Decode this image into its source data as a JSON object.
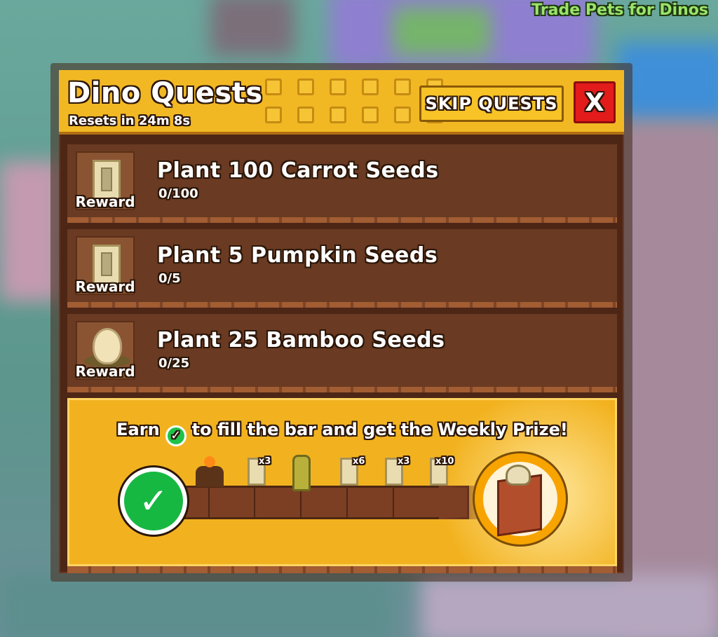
{
  "overlay": {
    "trade_label": "Trade Pets for Dinos"
  },
  "header": {
    "title": "Dino Quests",
    "reset_text": "Resets in 24m 8s",
    "skip_label": "SKIP QUESTS",
    "close_label": "X"
  },
  "quests": [
    {
      "title": "Plant 100 Carrot Seeds",
      "progress": "0/100",
      "reward_label": "Reward",
      "reward_icon": "seed-pack-icon"
    },
    {
      "title": "Plant 5 Pumpkin Seeds",
      "progress": "0/5",
      "reward_label": "Reward",
      "reward_icon": "seed-pack-icon"
    },
    {
      "title": "Plant 25 Bamboo Seeds",
      "progress": "0/25",
      "reward_label": "Reward",
      "reward_icon": "dino-egg-icon"
    }
  ],
  "weekly": {
    "earn_prefix": "Earn",
    "earn_suffix": "to fill the bar and get the Weekly Prize!",
    "milestones": [
      {
        "icon": "volcano-icon",
        "multiplier": ""
      },
      {
        "icon": "seed-pack-icon",
        "multiplier": "x3"
      },
      {
        "icon": "cactus-icon",
        "multiplier": ""
      },
      {
        "icon": "seed-pack-icon",
        "multiplier": "x6"
      },
      {
        "icon": "seed-pack-icon",
        "multiplier": "x3"
      },
      {
        "icon": "seed-pack-icon",
        "multiplier": "x10"
      }
    ],
    "progress_fraction": 0,
    "prize_icon": "weekly-prize-gift-icon"
  },
  "colors": {
    "header_yellow": "#f2b824",
    "panel_brown": "#4d2616",
    "close_red": "#e31b1b",
    "check_green": "#17b842"
  }
}
